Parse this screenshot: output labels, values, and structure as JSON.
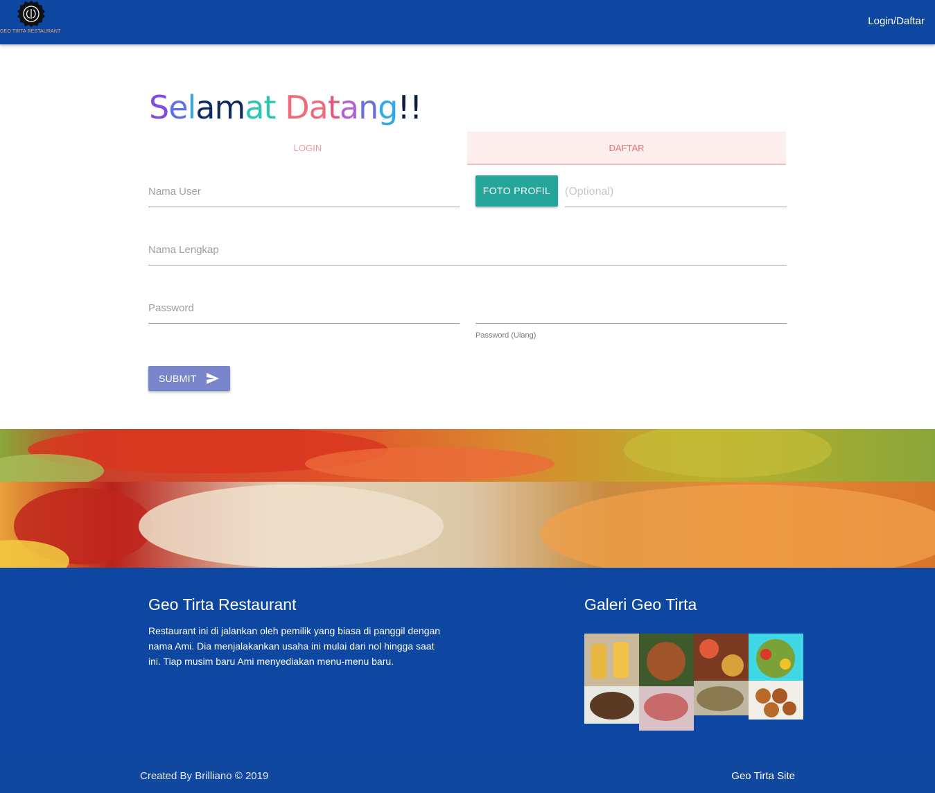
{
  "navbar": {
    "logo_text": "GEO TIRTA RESTAURANT",
    "login_link": "Login/Daftar",
    "bg_color": "#0d47a1"
  },
  "heading": {
    "letters": [
      {
        "ch": "S",
        "color": "#7c4dde"
      },
      {
        "ch": "e",
        "color": "#5f6fe8"
      },
      {
        "ch": "l",
        "color": "#3aa3e0"
      },
      {
        "ch": "a",
        "color": "#0d2b5e"
      },
      {
        "ch": "m",
        "color": "#0d2b5e"
      },
      {
        "ch": "a",
        "color": "#2ec4b6"
      },
      {
        "ch": "t",
        "color": "#2ec4b6"
      },
      {
        "ch": " ",
        "color": "#000000"
      },
      {
        "ch": "D",
        "color": "#f06b7a"
      },
      {
        "ch": "a",
        "color": "#f06b7a"
      },
      {
        "ch": "t",
        "color": "#e8557a"
      },
      {
        "ch": "a",
        "color": "#b062d6"
      },
      {
        "ch": "n",
        "color": "#6a6fe0"
      },
      {
        "ch": "g",
        "color": "#2fa9e8"
      },
      {
        "ch": "!",
        "color": "#0d1b3e"
      },
      {
        "ch": "!",
        "color": "#0d1b3e"
      }
    ]
  },
  "tabs": {
    "login": "LOGIN",
    "daftar": "DAFTAR"
  },
  "form": {
    "nama_user_label": "Nama User",
    "foto_profil_button": "FOTO PROFIL",
    "optional_placeholder": "(Optional)",
    "nama_lengkap_label": "Nama Lengkap",
    "password_label": "Password",
    "password_ulang_label": "Password (Ulang)",
    "submit_button": "SUBMIT"
  },
  "footer": {
    "title": "Geo Tirta Restaurant",
    "description": "Restaurant ini di jalankan oleh pemilik yang biasa di panggil dengan nama Ami. Dia menjalakankan usaha ini mulai dari nol hingga saat ini. Tiap musim baru Ami menyediakan menu-menu baru.",
    "gallery_title": "Galeri Geo Tirta",
    "copyright": "Created By Brilliano © 2019",
    "site_link": "Geo Tirta Site"
  },
  "colors": {
    "accent_teal": "#26a69a",
    "submit_indigo": "#7986cb",
    "tab_pink": "#e57373",
    "footer_blue": "#0d47a1"
  }
}
